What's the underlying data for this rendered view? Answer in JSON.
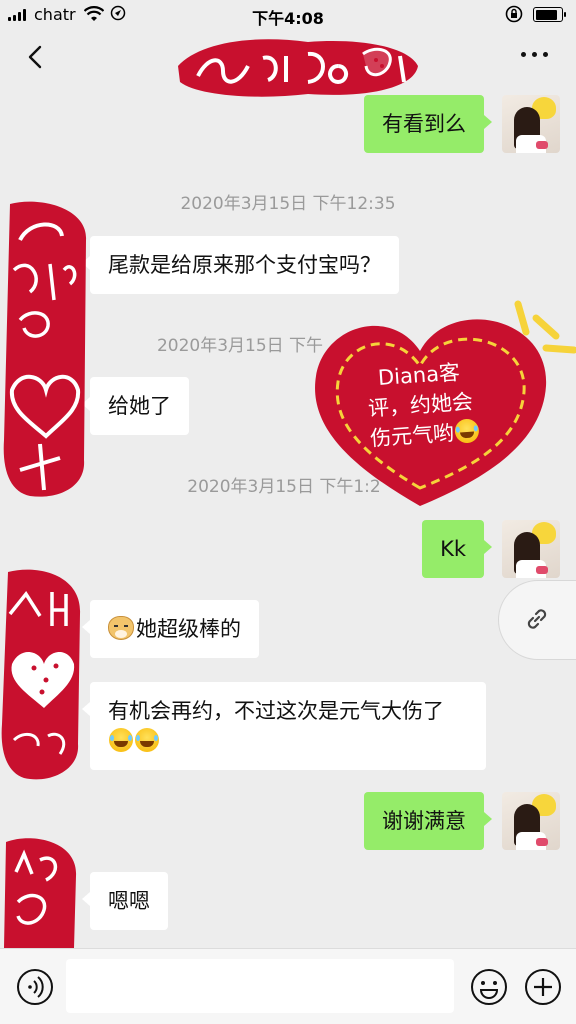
{
  "status_bar": {
    "carrier": "chatr",
    "time": "下午4:08",
    "battery_level": 0.85
  },
  "nav": {
    "back_icon": "chevron-left-icon",
    "more_icon": "more-dots-icon"
  },
  "messages": [
    {
      "kind": "out",
      "text": "有看到么"
    },
    {
      "kind": "timestamp",
      "text": "2020年3月15日 下午12:35"
    },
    {
      "kind": "in",
      "text": "尾款是给原来那个支付宝吗？"
    },
    {
      "kind": "timestamp",
      "text": "2020年3月15日 下午"
    },
    {
      "kind": "in",
      "text": "给她了"
    },
    {
      "kind": "timestamp",
      "text": "2020年3月15日 下午1:2"
    },
    {
      "kind": "out",
      "text": "Kk"
    },
    {
      "kind": "in",
      "text": "她超级棒的",
      "prefix_emoji": "doge"
    },
    {
      "kind": "in",
      "text": "有机会再约，不过这次是元气大伤了",
      "suffix_emoji": "laugh x2"
    },
    {
      "kind": "out",
      "text": "谢谢满意"
    },
    {
      "kind": "in",
      "text": "嗯嗯"
    }
  ],
  "heart_note": {
    "line1": "Diana客",
    "line2": "评，约她会",
    "line3": "伤元气哟"
  },
  "colors": {
    "outgoing_bubble": "#95ec69",
    "incoming_bubble": "#ffffff",
    "background": "#ededed",
    "sticker_red": "#c8102e"
  },
  "input_bar": {
    "value": "",
    "voice_icon": "voice-icon",
    "emoji_icon": "emoji-face-icon",
    "plus_icon": "plus-circle-icon"
  },
  "floating": {
    "link_icon": "link-icon"
  }
}
